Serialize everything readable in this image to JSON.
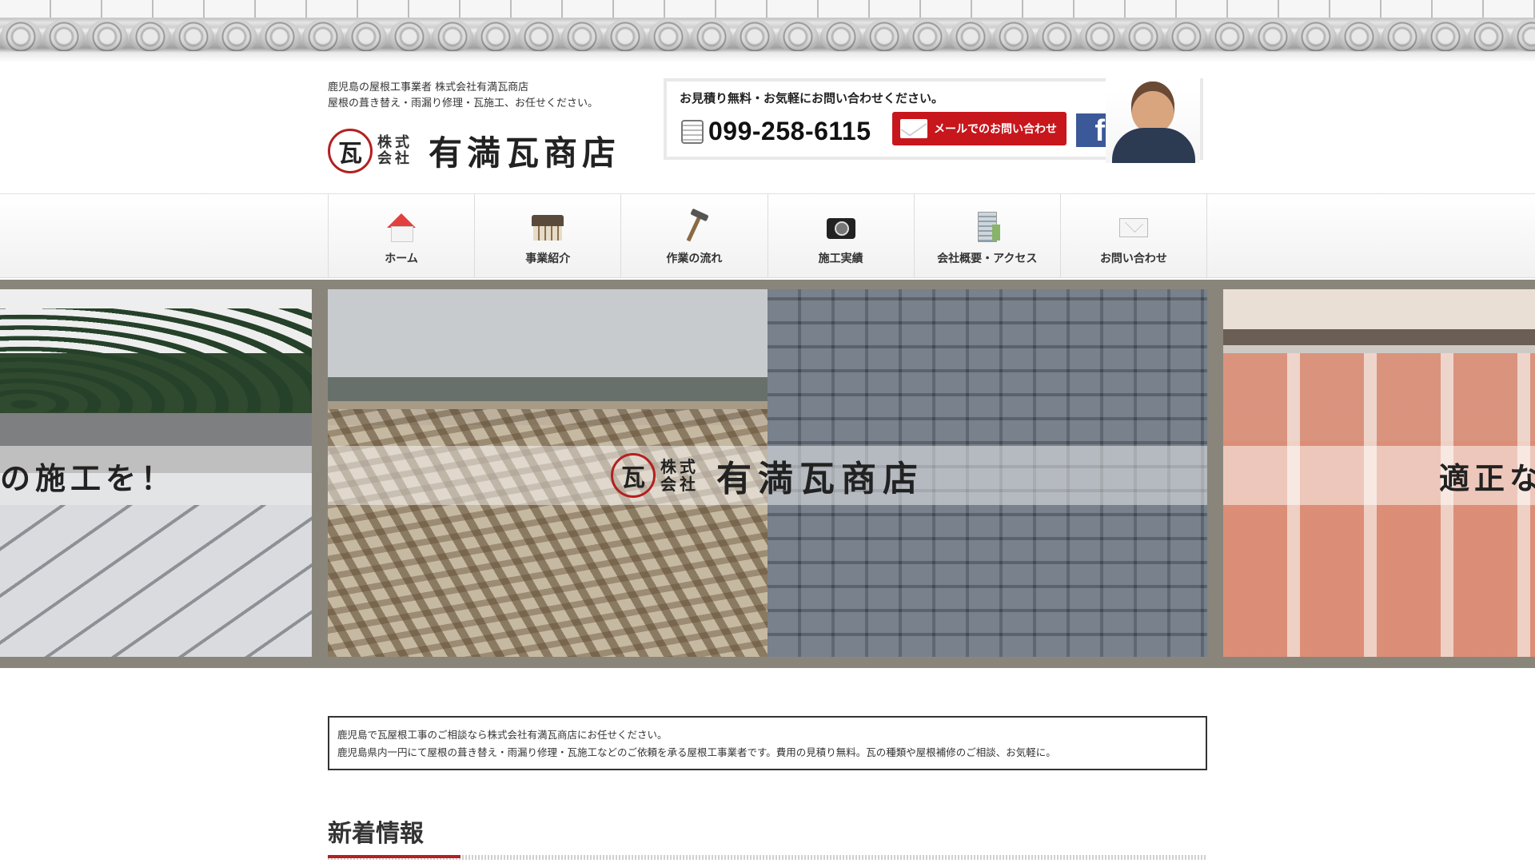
{
  "header": {
    "tagline_line1": "鹿児島の屋根工事業者 株式会社有満瓦商店",
    "tagline_line2": "屋根の葺き替え・雨漏り修理・瓦施工、お任せください。",
    "logo_mark": "瓦",
    "logo_kabu": "株式会社",
    "logo_name": "有満瓦商店"
  },
  "contact": {
    "message": "お見積り無料・お気軽にお問い合わせください。",
    "phone": "099-258-6115",
    "mail_label": "メールでのお問い合わせ",
    "facebook_label": "f"
  },
  "nav": {
    "items": [
      {
        "label": "ホーム",
        "icon": "home-icon"
      },
      {
        "label": "事業紹介",
        "icon": "shop-icon"
      },
      {
        "label": "作業の流れ",
        "icon": "hammer-icon"
      },
      {
        "label": "施工実績",
        "icon": "camera-icon"
      },
      {
        "label": "会社概要・アクセス",
        "icon": "building-icon"
      },
      {
        "label": "お問い合わせ",
        "icon": "mail-icon"
      }
    ]
  },
  "slider": {
    "left_caption": "全の施工を！",
    "main_mark": "瓦",
    "main_kabu": "株式会社",
    "main_name": "有満瓦商店",
    "right_caption": "適正な"
  },
  "intro": {
    "line1": "鹿児島で瓦屋根工事のご相談なら株式会社有満瓦商店にお任せください。",
    "line2": "鹿児島県内一円にて屋根の葺き替え・雨漏り修理・瓦施工などのご依頼を承る屋根工事業者です。費用の見積り無料。瓦の種類や屋根補修のご相談、お気軽に。"
  },
  "news": {
    "title": "新着情報"
  },
  "colors": {
    "accent": "#c8161d",
    "facebook": "#3b5998",
    "slider_frame": "#8a857b"
  }
}
